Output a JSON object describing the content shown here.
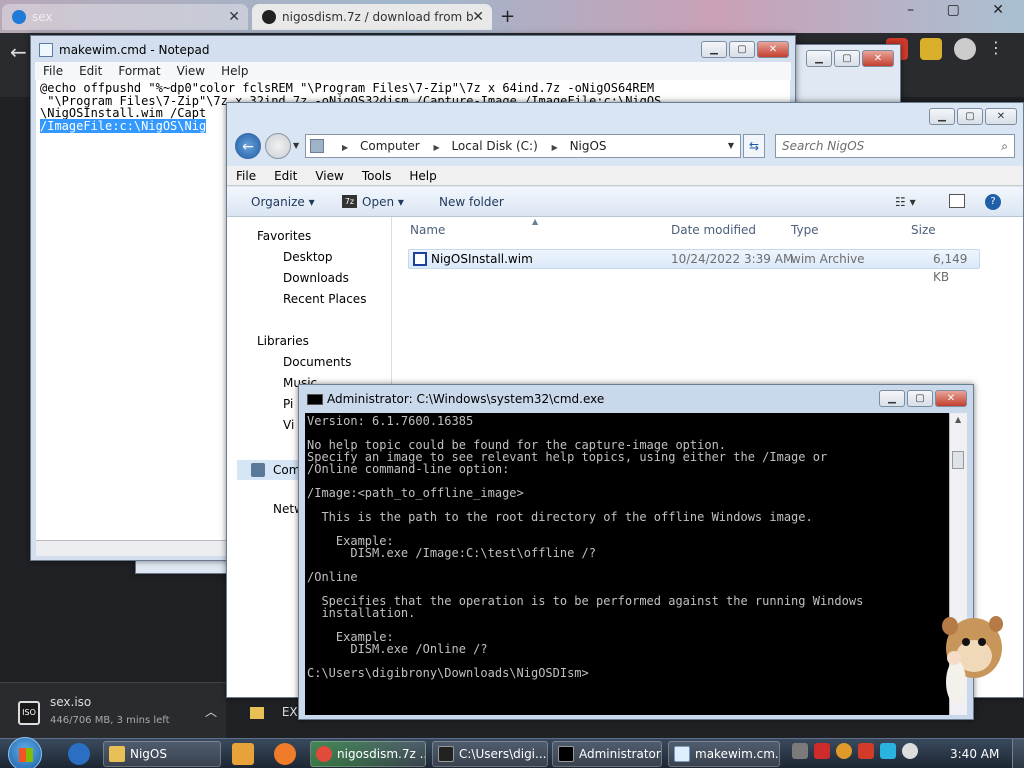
{
  "browser": {
    "tabs": [
      {
        "label": "sex",
        "close": "✕"
      },
      {
        "label": "nigosdism.7z / download from b",
        "close": "✕"
      }
    ],
    "newtab": "+",
    "window_controls": "– ▢ ✕"
  },
  "downloads": {
    "name": "sex.iso",
    "status": "446/706 MB, 3 mins left",
    "icon_text": "ISO"
  },
  "notepad": {
    "title": "makewim.cmd - Notepad",
    "menu": [
      "File",
      "Edit",
      "Format",
      "View",
      "Help"
    ],
    "lines": [
      "@echo offpushd \"%~dp0\"color fclsREM \"\\Program Files\\7-Zip\"\\7z x 64ind.7z -oNigOS64REM",
      " \"\\Program Files\\7-Zip\"\\7z x 32ind.7z -oNigOS32dism /Capture-Image /ImageFile:c:\\NigOS",
      "\\NigOSInstall.wim /Capt"
    ],
    "selected_line": "/ImageFile:c:\\NigOS\\Nig"
  },
  "explorer": {
    "breadcrumb": [
      "Computer",
      "Local Disk (C:)",
      "NigOS"
    ],
    "search_placeholder": "Search NigOS",
    "menu": [
      "File",
      "Edit",
      "View",
      "Tools",
      "Help"
    ],
    "commands": {
      "organize": "Organize ▾",
      "open": "Open ▾",
      "new_folder": "New folder"
    },
    "nav": {
      "favorites": "Favorites",
      "desktop": "Desktop",
      "downloads": "Downloads",
      "recent": "Recent Places",
      "libraries": "Libraries",
      "documents": "Documents",
      "music": "Music",
      "pictures": "Pi",
      "videos": "Vi",
      "computer": "Com",
      "network": "Netw"
    },
    "columns": {
      "name": "Name",
      "date": "Date modified",
      "type": "Type",
      "size": "Size"
    },
    "files": [
      {
        "name": "NigOSInstall.wim",
        "date": "10/24/2022 3:39 AM",
        "type": "wim Archive",
        "size": "6,149 KB"
      }
    ],
    "wim_badge": "W"
  },
  "cmd": {
    "title": "Administrator: C:\\Windows\\system32\\cmd.exe",
    "lines": [
      "Version: 6.1.7600.16385",
      "",
      "No help topic could be found for the capture-image option.",
      "Specify an image to see relevant help topics, using either the /Image or",
      "/Online command-line option:",
      "",
      "/Image:<path_to_offline_image>",
      "",
      "  This is the path to the root directory of the offline Windows image.",
      "",
      "    Example:",
      "      DISM.exe /Image:C:\\test\\offline /?",
      "",
      "/Online",
      "",
      "  Specifies that the operation is to be performed against the running Windows",
      "  installation.",
      "",
      "    Example:",
      "      DISM.exe /Online /?",
      "",
      "C:\\Users\\digibrony\\Downloads\\NigOSDIsm>"
    ]
  },
  "taskbar": {
    "items": [
      {
        "label": "NigOS"
      },
      {
        "label": "nigosdism.7z ..."
      },
      {
        "label": "C:\\Users\\digi..."
      },
      {
        "label": "Administrator:..."
      },
      {
        "label": "makewim.cm..."
      }
    ],
    "clock": "3:40 AM",
    "ex_label": "EX"
  },
  "colors": {
    "selection": "#3399ff",
    "cmd_bg": "#000000",
    "cmd_text": "#c0c0c0",
    "close_red": "#c2402f"
  }
}
